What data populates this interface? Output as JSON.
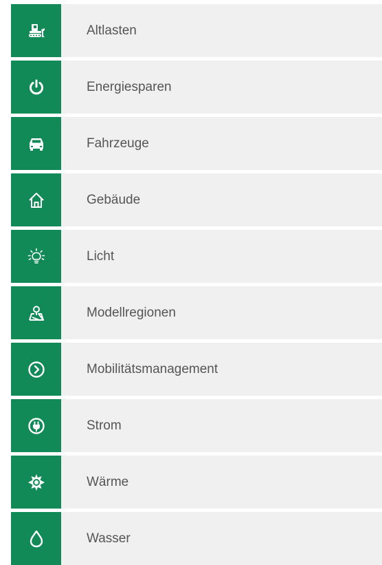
{
  "accent_color": "#128a58",
  "menu": {
    "items": [
      {
        "label": "Altlasten",
        "icon": "bulldozer-icon"
      },
      {
        "label": "Energiesparen",
        "icon": "power-icon"
      },
      {
        "label": "Fahrzeuge",
        "icon": "car-icon"
      },
      {
        "label": "Gebäude",
        "icon": "house-icon"
      },
      {
        "label": "Licht",
        "icon": "lightbulb-icon"
      },
      {
        "label": "Modellregionen",
        "icon": "map-pin-icon"
      },
      {
        "label": "Mobilitätsmanagement",
        "icon": "chevron-circle-icon"
      },
      {
        "label": "Strom",
        "icon": "plug-icon"
      },
      {
        "label": "Wärme",
        "icon": "sun-icon"
      },
      {
        "label": "Wasser",
        "icon": "water-drop-icon"
      }
    ]
  }
}
